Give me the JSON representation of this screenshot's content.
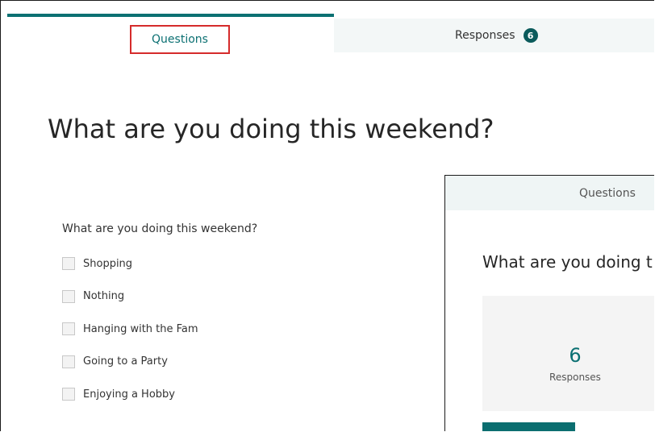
{
  "tabs": {
    "questions_label": "Questions",
    "responses_label": "Responses",
    "responses_count": "6"
  },
  "form": {
    "title": "What are you doing this weekend?",
    "question": "What are you doing this weekend?",
    "options": [
      "Shopping",
      "Nothing",
      "Hanging with the Fam",
      "Going to a Party",
      "Enjoying a Hobby"
    ]
  },
  "overlay": {
    "tab_label": "Questions",
    "title": "What are you doing t",
    "responses_count": "6",
    "responses_label": "Responses"
  },
  "colors": {
    "accent": "#0b7072",
    "highlight_box": "#d52b2b"
  }
}
